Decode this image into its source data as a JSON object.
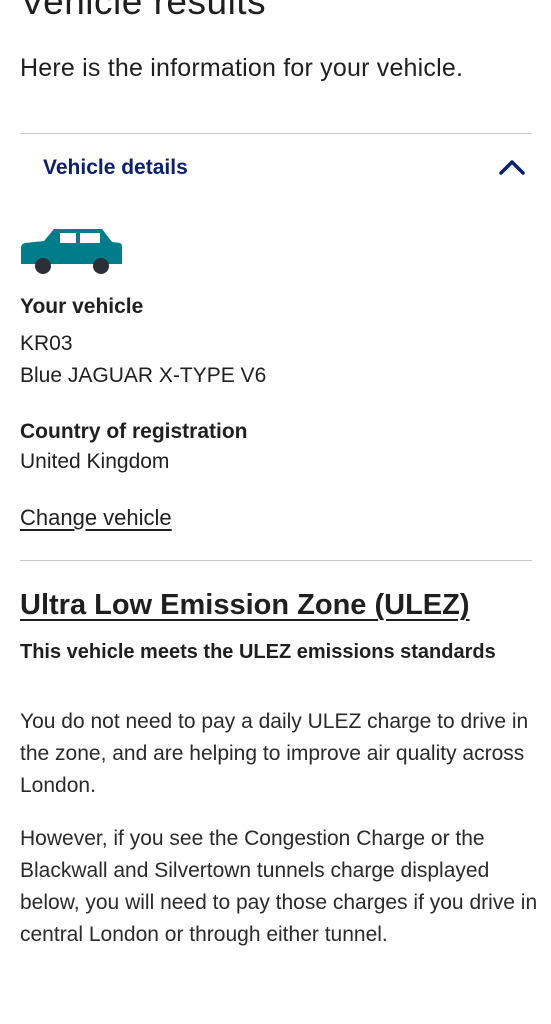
{
  "page": {
    "title": "Vehicle results",
    "intro": "Here is the information for your vehicle."
  },
  "accordion": {
    "title": "Vehicle details",
    "chevron_icon": "chevron-up-icon",
    "car_icon": "car-icon",
    "car_color": "#007d8a"
  },
  "vehicle": {
    "label": "Your vehicle",
    "registration": "KR03",
    "description": "Blue JAGUAR X-TYPE V6",
    "country_label": "Country of registration",
    "country": "United Kingdom",
    "change_link": "Change vehicle"
  },
  "ulez": {
    "heading": "Ultra Low Emission Zone (ULEZ)",
    "status": "This vehicle meets the ULEZ emissions standards",
    "paragraph1": "You do not need to pay a daily ULEZ charge to drive in the zone, and are helping to improve air quality across London.",
    "paragraph2": "However, if you see the Congestion Charge or the Blackwall and Silvertown tunnels charge displayed below, you will need to pay those charges if you drive in central London or through either tunnel."
  },
  "colors": {
    "accent": "#0c2072",
    "text": "#1f1f1f",
    "divider": "#c9c9c9"
  }
}
